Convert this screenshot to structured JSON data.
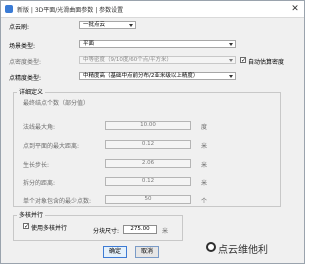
{
  "window": {
    "title": "新版 | 3D平面/光滑曲面参数 | 参数设置"
  },
  "form": {
    "point_cloud": {
      "label": "点云刷:",
      "value": "一批点云"
    },
    "scene_type": {
      "label": "场景类型:",
      "value": "平面"
    },
    "point_density": {
      "label": "点密度类型:",
      "value": "中等密度（9/10度/60个点/平方米）",
      "auto_label": "自动估算密度"
    },
    "point_feature": {
      "label": "点精度类型:",
      "value": "中精度高（基础中点前分布/2亚米级以上精度）"
    }
  },
  "params_group": {
    "title": "详细定义",
    "desc": "最终结点个数（部分值）",
    "rows": [
      {
        "label": "法线最大角:",
        "value": "10.00",
        "unit": "度"
      },
      {
        "label": "点到平面的最大距离:",
        "value": "0.12",
        "unit": "米"
      },
      {
        "label": "生长步长:",
        "value": "2.06",
        "unit": "米"
      },
      {
        "label": "拆分的距离:",
        "value": "0.12",
        "unit": "米"
      },
      {
        "label": "单个对象包含的最少点数:",
        "value": "50",
        "unit": "个"
      }
    ]
  },
  "parallel_group": {
    "title": "多核并行",
    "checkbox_label": "使用多核并行",
    "block_label": "分块尺寸:",
    "block_value": "275.00",
    "block_unit": "米"
  },
  "buttons": {
    "ok": "确定",
    "cancel": "取消"
  },
  "watermark": {
    "text": "点云维他利"
  }
}
